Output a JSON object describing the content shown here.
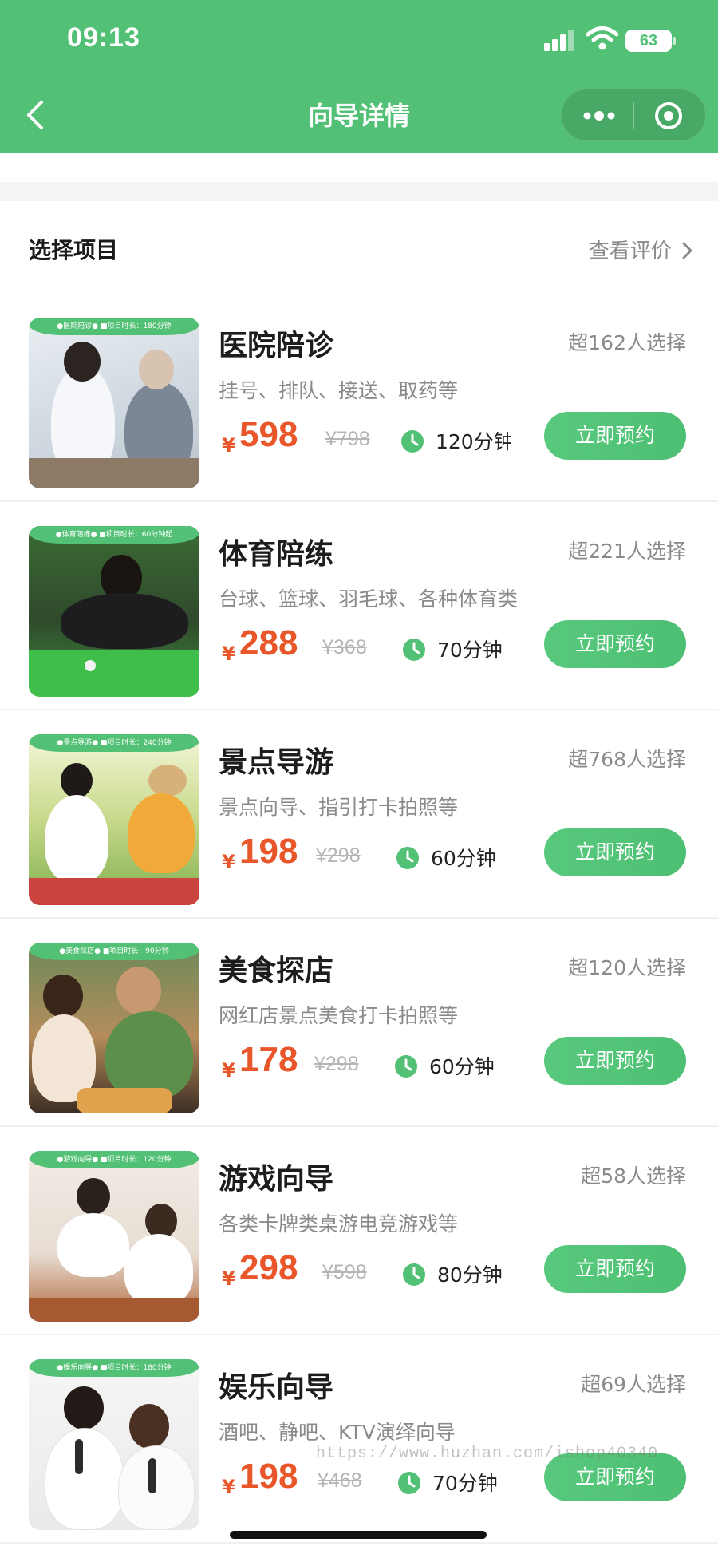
{
  "status_bar": {
    "time": "09:13",
    "battery": "63"
  },
  "nav": {
    "title": "向导详情"
  },
  "section": {
    "title": "选择项目",
    "reviews_link": "查看评价"
  },
  "colors": {
    "brand_green": "#52c075",
    "price_orange": "#e8562a"
  },
  "items": [
    {
      "banner": "●医院陪诊●  ■项目时长：180分钟",
      "title": "医院陪诊",
      "count": "超162人选择",
      "desc": "挂号、排队、接送、取药等",
      "yen": "¥",
      "price": "598",
      "original": "¥798",
      "duration": "120分钟",
      "button": "立即预约"
    },
    {
      "banner": "●体育陪练●  ■项目时长：60分钟起",
      "title": "体育陪练",
      "count": "超221人选择",
      "desc": "台球、篮球、羽毛球、各种体育类",
      "yen": "¥",
      "price": "288",
      "original": "¥368",
      "duration": "70分钟",
      "button": "立即预约"
    },
    {
      "banner": "●景点导游●  ■项目时长：240分钟",
      "title": "景点导游",
      "count": "超768人选择",
      "desc": "景点向导、指引打卡拍照等",
      "yen": "¥",
      "price": "198",
      "original": "¥298",
      "duration": "60分钟",
      "button": "立即预约"
    },
    {
      "banner": "●美食探店●  ■项目时长：90分钟",
      "title": "美食探店",
      "count": "超120人选择",
      "desc": "网红店景点美食打卡拍照等",
      "yen": "¥",
      "price": "178",
      "original": "¥298",
      "duration": "60分钟",
      "button": "立即预约"
    },
    {
      "banner": "●游戏向导●  ■项目时长：120分钟",
      "title": "游戏向导",
      "count": "超58人选择",
      "desc": "各类卡牌类桌游电竞游戏等",
      "yen": "¥",
      "price": "298",
      "original": "¥598",
      "duration": "80分钟",
      "button": "立即预约"
    },
    {
      "banner": "●娱乐向导●  ■项目时长：180分钟",
      "title": "娱乐向导",
      "count": "超69人选择",
      "desc": "酒吧、静吧、KTV演绎向导",
      "yen": "¥",
      "price": "198",
      "original": "¥468",
      "duration": "70分钟",
      "button": "立即预约"
    }
  ],
  "watermark": "https://www.huzhan.com/ishop40340"
}
